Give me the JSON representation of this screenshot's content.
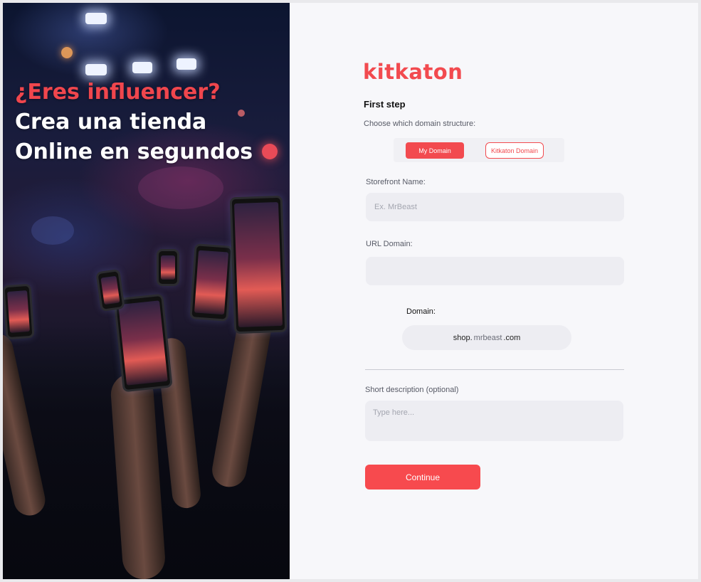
{
  "hero": {
    "line1": "¿Eres influencer?",
    "line2": "Crea una tienda",
    "line3": "Online en segundos",
    "accent_color": "#f0464d"
  },
  "brand": {
    "logo_text": "kitkaton",
    "color": "#f24a4f"
  },
  "form": {
    "step_title": "First step",
    "domain_structure_label": "Choose which domain structure:",
    "options": {
      "my_domain": "My Domain",
      "kitkaton_domain": "Kitkaton Domain",
      "selected": "My Domain"
    },
    "storefront": {
      "label": "Storefront Name:",
      "placeholder": "Ex. MrBeast",
      "value": ""
    },
    "url_domain": {
      "label": "URL Domain:",
      "placeholder": "",
      "value": ""
    },
    "domain_preview": {
      "label": "Domain:",
      "prefix": "shop.",
      "name": "mrbeast",
      "suffix": ".com"
    },
    "description": {
      "label": "Short description (optional)",
      "placeholder": "Type here..."
    },
    "continue_label": "Continue"
  }
}
